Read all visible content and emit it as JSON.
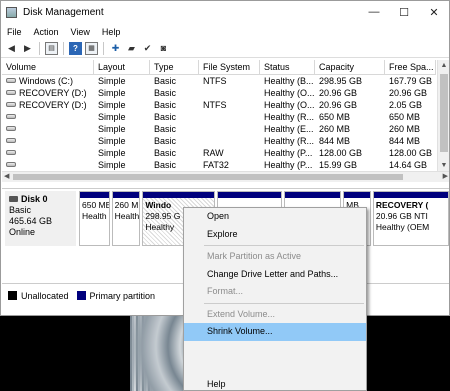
{
  "window": {
    "title": "Disk Management",
    "controls": {
      "minimize": "—",
      "maximize": "☐",
      "close": "✕"
    }
  },
  "menu": {
    "items": [
      "File",
      "Action",
      "View",
      "Help"
    ]
  },
  "toolbar": {
    "icons": [
      "back-arrow-icon",
      "forward-arrow-icon",
      "disk-list-icon",
      "help-icon",
      "properties-icon",
      "settings-icon",
      "folder-open-icon",
      "disk-check-icon",
      "disk-refresh-icon"
    ],
    "help_label": "?"
  },
  "volume_table": {
    "columns": [
      "Volume",
      "Layout",
      "Type",
      "File System",
      "Status",
      "Capacity",
      "Free Spa..."
    ],
    "rows": [
      [
        "Windows (C:)",
        "Simple",
        "Basic",
        "NTFS",
        "Healthy (B...",
        "298.95 GB",
        "167.79 GB"
      ],
      [
        "RECOVERY (D:)",
        "Simple",
        "Basic",
        "",
        "Healthy (O...",
        "20.96 GB",
        "20.96 GB"
      ],
      [
        "RECOVERY (D:)",
        "Simple",
        "Basic",
        "NTFS",
        "Healthy (O...",
        "20.96 GB",
        "2.05 GB"
      ],
      [
        "",
        "Simple",
        "Basic",
        "",
        "Healthy (R...",
        "650 MB",
        "650 MB"
      ],
      [
        "",
        "Simple",
        "Basic",
        "",
        "Healthy (E...",
        "260 MB",
        "260 MB"
      ],
      [
        "",
        "Simple",
        "Basic",
        "",
        "Healthy (R...",
        "844 MB",
        "844 MB"
      ],
      [
        "",
        "Simple",
        "Basic",
        "RAW",
        "Healthy (P...",
        "128.00 GB",
        "128.00 GB"
      ],
      [
        "",
        "Simple",
        "Basic",
        "FAT32",
        "Healthy (P...",
        "15.99 GB",
        "14.64 GB"
      ]
    ]
  },
  "disk": {
    "name": "Disk 0",
    "type": "Basic",
    "size": "465.64 GB",
    "status": "Online"
  },
  "partitions": [
    {
      "line1": "650 ME",
      "line2": "Health"
    },
    {
      "line1": "260 M",
      "line2": "Health"
    },
    {
      "line1": "Windo",
      "line2": "298.95 G",
      "line3": "Healthy"
    },
    {
      "line1": "",
      "line2": "",
      "line3": ""
    },
    {
      "line1": "",
      "line2": "",
      "line3": ""
    },
    {
      "line1": "MB",
      "line2": "ealth"
    },
    {
      "line1": "RECOVERY  (",
      "line2": "20.96 GB NTI",
      "line3": "Healthy (OEM"
    }
  ],
  "legend": {
    "items": [
      {
        "label": "Unallocated",
        "color": "#000000"
      },
      {
        "label": "Primary partition",
        "color": "#00007d"
      }
    ]
  },
  "context_menu": {
    "items": [
      {
        "label": "Open",
        "disabled": false
      },
      {
        "label": "Explore",
        "disabled": false
      },
      {
        "separator": true
      },
      {
        "label": "Mark Partition as Active",
        "disabled": true
      },
      {
        "label": "Change Drive Letter and Paths...",
        "disabled": false
      },
      {
        "label": "Format...",
        "disabled": true
      },
      {
        "separator": true
      },
      {
        "label": "Extend Volume...",
        "disabled": true
      },
      {
        "label": "Shrink Volume...",
        "disabled": false,
        "highlighted": true
      },
      {
        "label": "Help",
        "disabled": false
      }
    ]
  },
  "colors": {
    "primary_partition": "#00007d",
    "menu_highlight": "#91c9f7"
  }
}
